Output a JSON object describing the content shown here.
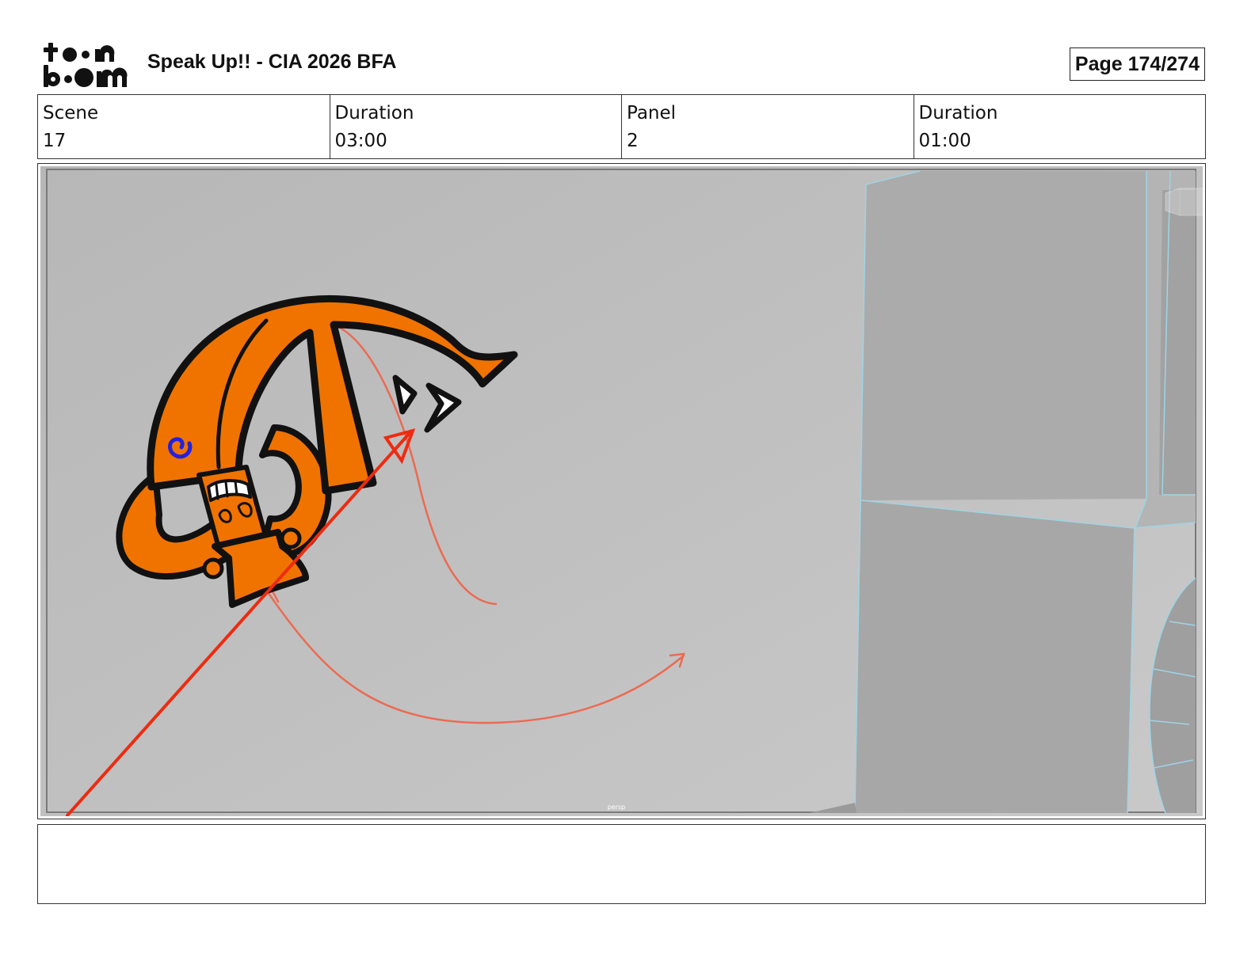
{
  "header": {
    "logo_text": "toon boom",
    "title": "Speak Up!! - CIA 2026 BFA",
    "page": "Page 174/274"
  },
  "info": {
    "scene_label": "Scene",
    "scene_value": "17",
    "scene_duration_label": "Duration",
    "scene_duration_value": "03:00",
    "panel_label": "Panel",
    "panel_value": "2",
    "panel_duration_label": "Duration",
    "panel_duration_value": "01:00"
  },
  "frame": {
    "viewport_label": "persp"
  },
  "notes": {
    "text": ""
  },
  "colors": {
    "character_orange": "#F07300",
    "arrow_red": "#EE2B10",
    "motion_line": "#EC6A52",
    "background_grey": "#C1C1C1",
    "wall_grey": "#ABABAB",
    "edge_cyan": "#9ED4E6",
    "swirl_blue": "#2222DD"
  }
}
